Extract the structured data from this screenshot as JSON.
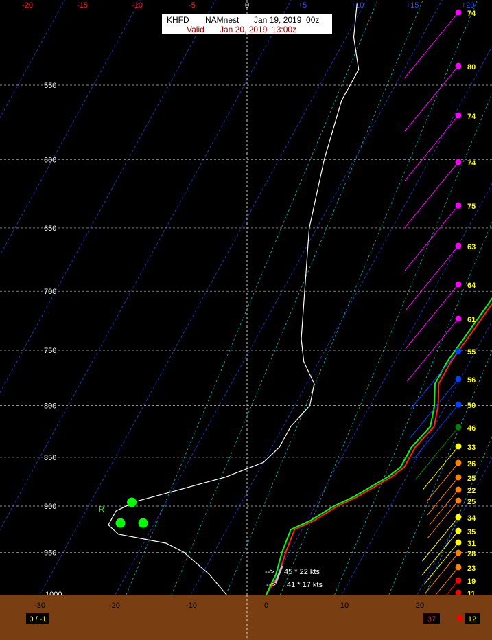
{
  "header": {
    "station": "KHFD",
    "model": "NAMnest",
    "run": "Jan 19, 2019  00z",
    "valid_label": "Valid",
    "valid_time": "Jan 20, 2019  13:00z"
  },
  "colors": {
    "background": "#000000",
    "ground": "#7a3e13",
    "temperature": "#ff2020",
    "dewpoint": "#00ff00",
    "wetbulb": "#ffffff",
    "isotherm": "#2030c0",
    "mixing_ratio": "#00c0c0",
    "top_temp_labels": "#ff2020",
    "top_plus_labels": "#3050ff"
  },
  "chart_data": {
    "type": "line",
    "title": "",
    "y_axis": {
      "label": "",
      "scale": "log-pressure",
      "range": [
        1000,
        500
      ],
      "ticks": [
        550,
        600,
        650,
        700,
        750,
        800,
        850,
        900,
        950,
        1000
      ]
    },
    "bottom_x_axis": {
      "range": [
        -30,
        30
      ],
      "ticks": [
        -30,
        -20,
        -10,
        0,
        10,
        20
      ]
    },
    "top_x_axis": {
      "ticks": [
        "-20",
        "-15",
        "-10",
        "-5",
        "0",
        "+5",
        "+10",
        "+15",
        "+20"
      ]
    },
    "series": [
      {
        "key": "temperature",
        "points": [
          [
            1000,
            0.0
          ],
          [
            975,
            0.2
          ],
          [
            950,
            -0.5
          ],
          [
            925,
            -1.0
          ],
          [
            915,
            1.0
          ],
          [
            900,
            3.0
          ],
          [
            890,
            5.0
          ],
          [
            880,
            6.5
          ],
          [
            870,
            8.0
          ],
          [
            860,
            9.0
          ],
          [
            840,
            9.0
          ],
          [
            820,
            10.0
          ],
          [
            800,
            9.0
          ],
          [
            780,
            7.5
          ],
          [
            760,
            7.5
          ],
          [
            740,
            8.0
          ],
          [
            700,
            9.0
          ],
          [
            650,
            8.5
          ],
          [
            600,
            8.0
          ],
          [
            550,
            7.5
          ]
        ]
      },
      {
        "key": "dewpoint",
        "points": [
          [
            1000,
            0.0
          ],
          [
            975,
            -0.2
          ],
          [
            950,
            -1.0
          ],
          [
            925,
            -1.5
          ],
          [
            915,
            0.5
          ],
          [
            900,
            2.5
          ],
          [
            890,
            4.5
          ],
          [
            880,
            6.0
          ],
          [
            870,
            7.5
          ],
          [
            860,
            8.5
          ],
          [
            840,
            8.5
          ],
          [
            820,
            9.5
          ],
          [
            800,
            8.5
          ],
          [
            780,
            7.0
          ],
          [
            760,
            7.0
          ],
          [
            740,
            7.5
          ],
          [
            700,
            8.5
          ],
          [
            650,
            7.5
          ],
          [
            600,
            6.5
          ],
          [
            550,
            4.8
          ]
        ]
      },
      {
        "key": "wetbulb",
        "points": [
          [
            1000,
            -5.0
          ],
          [
            975,
            -9.0
          ],
          [
            950,
            -14.0
          ],
          [
            940,
            -17.0
          ],
          [
            930,
            -24.0
          ],
          [
            920,
            -26.0
          ],
          [
            905,
            -26.0
          ],
          [
            895,
            -24.0
          ],
          [
            885,
            -20.0
          ],
          [
            870,
            -14.0
          ],
          [
            855,
            -10.0
          ],
          [
            840,
            -9.0
          ],
          [
            820,
            -9.0
          ],
          [
            800,
            -8.0
          ],
          [
            780,
            -9.0
          ],
          [
            760,
            -12.0
          ],
          [
            740,
            -14.0
          ],
          [
            700,
            -17.0
          ],
          [
            650,
            -21.0
          ],
          [
            600,
            -24.0
          ],
          [
            560,
            -26.0
          ],
          [
            540,
            -26.0
          ],
          [
            520,
            -29.0
          ],
          [
            500,
            -31.0
          ]
        ]
      }
    ],
    "markers_pressure": [
      {
        "pressure": 896,
        "x": -26.0,
        "color": "#00ff00"
      },
      {
        "pressure": 918,
        "x": -27.5,
        "color": "#00ff00"
      },
      {
        "pressure": 918,
        "x": -24.5,
        "color": "#00ff00"
      }
    ],
    "marker_label": {
      "text": "R",
      "pressure": 902,
      "x": -22.0
    },
    "storm_motion": [
      {
        "text": "45 * 22 kts",
        "pressure": 972
      },
      {
        "text": "41 * 17 kts",
        "pressure": 985
      }
    ],
    "wind_speeds": [
      {
        "speed": "74",
        "pressure": 500,
        "color": "#ff00ff"
      },
      {
        "speed": "80",
        "pressure": 530,
        "color": "#ff00ff"
      },
      {
        "speed": "74",
        "pressure": 570,
        "color": "#ff00ff"
      },
      {
        "speed": "74",
        "pressure": 602,
        "color": "#ff00ff"
      },
      {
        "speed": "75",
        "pressure": 635,
        "color": "#ff00ff"
      },
      {
        "speed": "63",
        "pressure": 670,
        "color": "#ff00ff"
      },
      {
        "speed": "64",
        "pressure": 695,
        "color": "#ff00ff"
      },
      {
        "speed": "61",
        "pressure": 722,
        "color": "#ff00ff"
      },
      {
        "speed": "55",
        "pressure": 750,
        "color": "#0040ff"
      },
      {
        "speed": "56",
        "pressure": 775,
        "color": "#0040ff"
      },
      {
        "speed": "50",
        "pressure": 800,
        "color": "#0040ff"
      },
      {
        "speed": "46",
        "pressure": 820,
        "color": "#008000"
      },
      {
        "speed": "33",
        "pressure": 838,
        "color": "#ffff00"
      },
      {
        "speed": "26",
        "pressure": 853,
        "color": "#ff8000"
      },
      {
        "speed": "25",
        "pressure": 868,
        "color": "#ff8000"
      },
      {
        "speed": "22",
        "pressure": 880,
        "color": "#ff8000"
      },
      {
        "speed": "25",
        "pressure": 895,
        "color": "#ff8000"
      },
      {
        "speed": "34",
        "pressure": 911,
        "color": "#ffff00"
      },
      {
        "speed": "35",
        "pressure": 925,
        "color": "#ffff00"
      },
      {
        "speed": "31",
        "pressure": 935,
        "color": "#ffff00"
      },
      {
        "speed": "28",
        "pressure": 948,
        "color": "#ff8000"
      },
      {
        "speed": "23",
        "pressure": 962,
        "color": "#ff8000"
      },
      {
        "speed": "19",
        "pressure": 978,
        "color": "#ff0000"
      },
      {
        "speed": "11",
        "pressure": 990,
        "color": "#ff0000"
      }
    ],
    "pressure_label_1000_partial": "1000"
  },
  "footer": {
    "left_box": "0 / -1",
    "right_box_1": "37",
    "right_box_2": "12"
  }
}
